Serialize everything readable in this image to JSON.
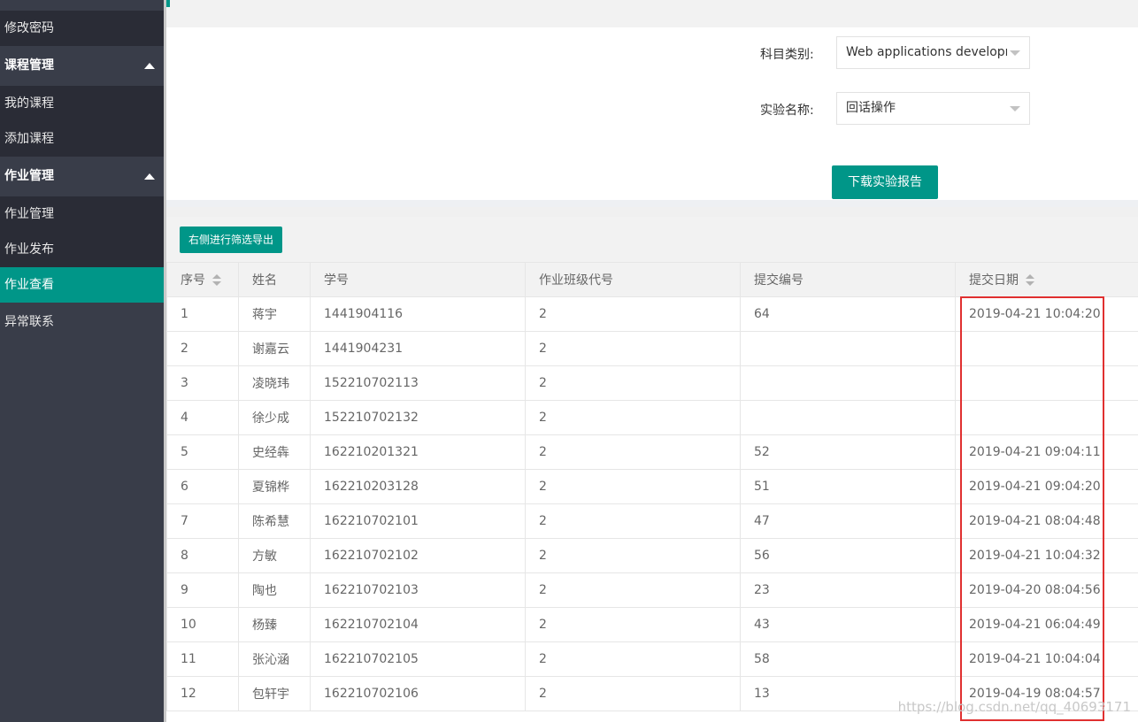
{
  "sidebar": {
    "items": [
      {
        "label": "修改密码",
        "type": "sub"
      },
      {
        "label": "课程管理",
        "type": "header"
      },
      {
        "label": "我的课程",
        "type": "sub"
      },
      {
        "label": "添加课程",
        "type": "sub"
      },
      {
        "label": "作业管理",
        "type": "header"
      },
      {
        "label": "作业管理",
        "type": "sub"
      },
      {
        "label": "作业发布",
        "type": "sub"
      },
      {
        "label": "作业查看",
        "type": "active"
      },
      {
        "label": "异常联系",
        "type": "plain"
      }
    ]
  },
  "filters": {
    "subject_label": "科目类别:",
    "subject_value": "Web applications developme",
    "experiment_label": "实验名称:",
    "experiment_value": "回话操作",
    "download_button": "下载实验报告"
  },
  "toolbar": {
    "export_button": "右侧进行筛选导出"
  },
  "table": {
    "headers": [
      "序号",
      "姓名",
      "学号",
      "作业班级代号",
      "提交编号",
      "提交日期"
    ],
    "rows": [
      [
        "1",
        "蒋宇",
        "1441904116",
        "2",
        "64",
        "2019-04-21 10:04:20"
      ],
      [
        "2",
        "谢嘉云",
        "1441904231",
        "2",
        "",
        ""
      ],
      [
        "3",
        "凌晓玮",
        "152210702113",
        "2",
        "",
        ""
      ],
      [
        "4",
        "徐少成",
        "152210702132",
        "2",
        "",
        ""
      ],
      [
        "5",
        "史经犇",
        "162210201321",
        "2",
        "52",
        "2019-04-21 09:04:11"
      ],
      [
        "6",
        "夏锦桦",
        "162210203128",
        "2",
        "51",
        "2019-04-21 09:04:20"
      ],
      [
        "7",
        "陈希慧",
        "162210702101",
        "2",
        "47",
        "2019-04-21 08:04:48"
      ],
      [
        "8",
        "方敏",
        "162210702102",
        "2",
        "56",
        "2019-04-21 10:04:32"
      ],
      [
        "9",
        "陶也",
        "162210702103",
        "2",
        "23",
        "2019-04-20 08:04:56"
      ],
      [
        "10",
        "杨臻",
        "162210702104",
        "2",
        "43",
        "2019-04-21 06:04:49"
      ],
      [
        "11",
        "张沁涵",
        "162210702105",
        "2",
        "58",
        "2019-04-21 10:04:04"
      ],
      [
        "12",
        "包轩宇",
        "162210702106",
        "2",
        "13",
        "2019-04-19 08:04:57"
      ]
    ]
  },
  "watermark": "https://blog.csdn.net/qq_40693171",
  "colors": {
    "accent": "#009688",
    "sidebar": "#393d49",
    "highlight_box": "#e03030"
  }
}
